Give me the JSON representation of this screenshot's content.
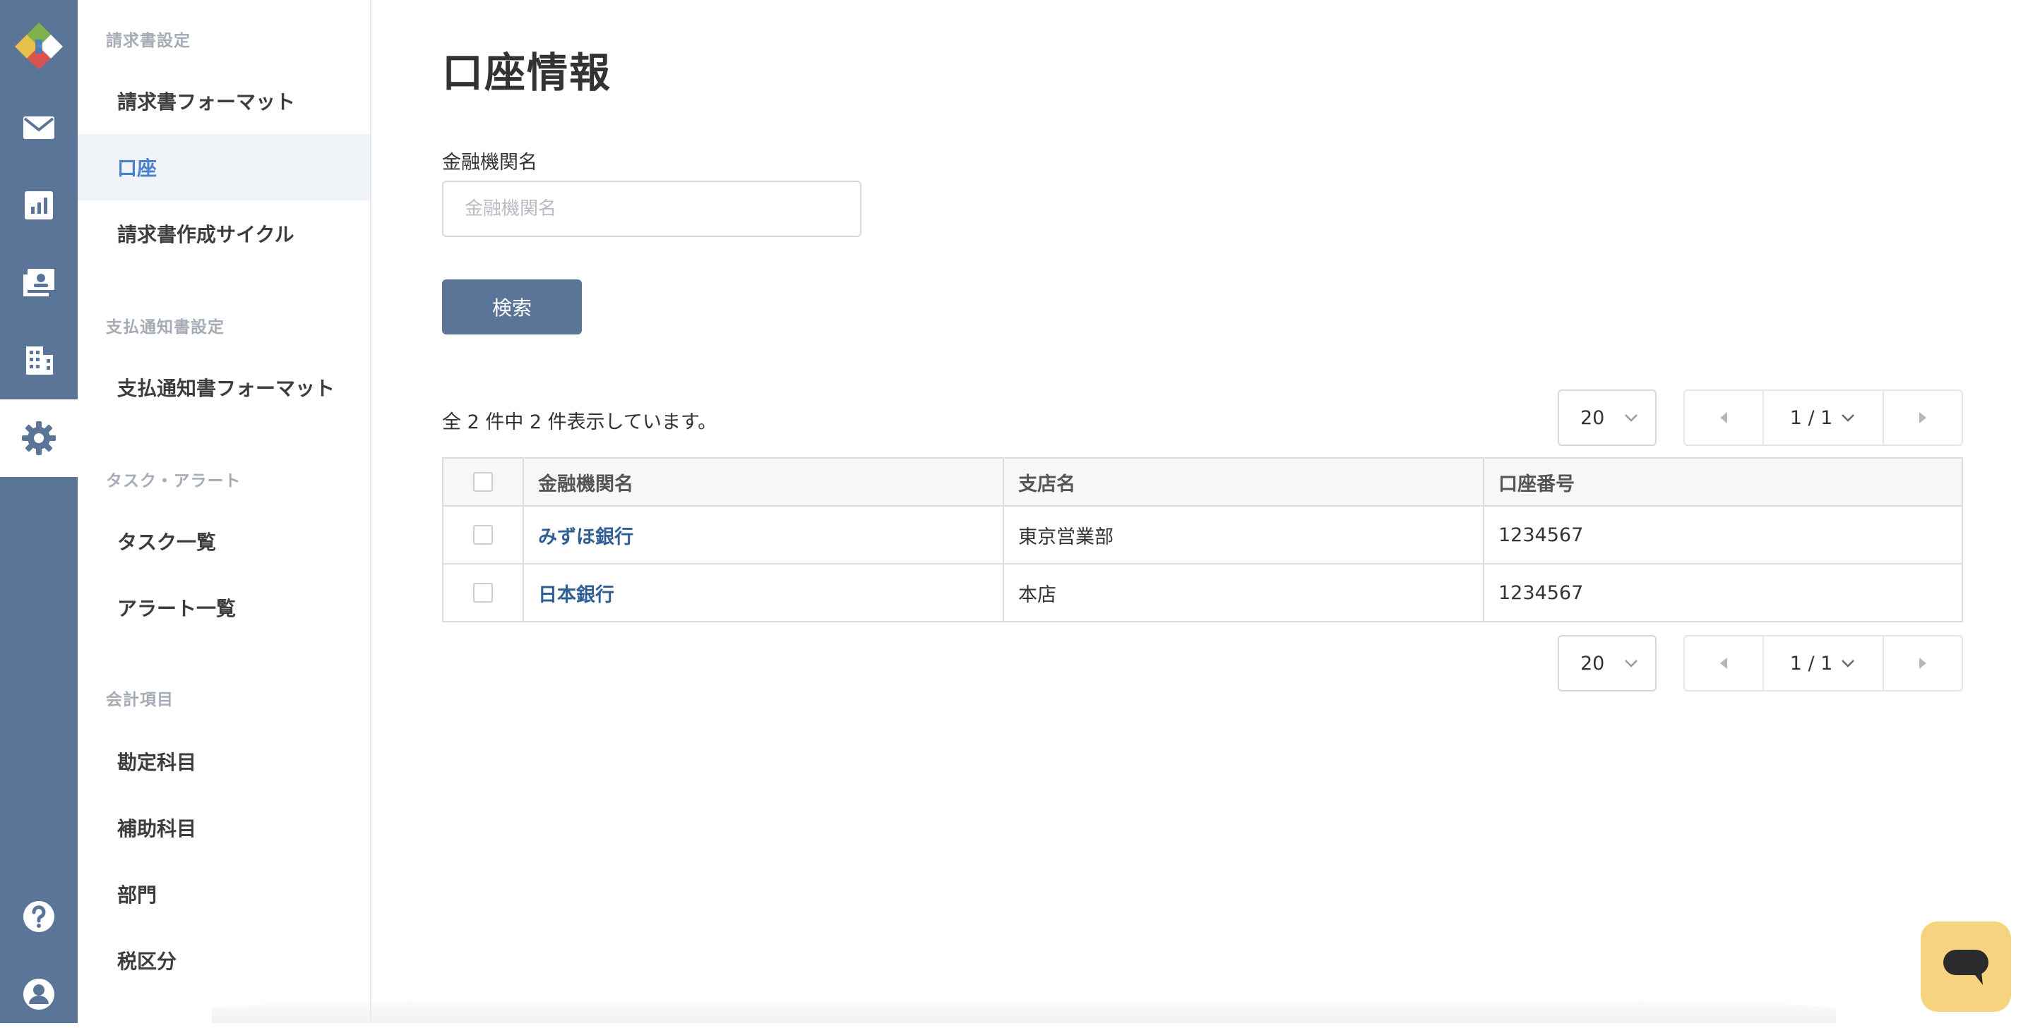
{
  "colors": {
    "rail": "#5b7599",
    "accent_active": "#4a7fc9",
    "link": "#2f5f94",
    "chat": "#f6d37f"
  },
  "rail": {
    "items": [
      {
        "icon": "mail-icon"
      },
      {
        "icon": "chart-icon"
      },
      {
        "icon": "invoice-icon"
      },
      {
        "icon": "building-icon"
      },
      {
        "icon": "gear-icon",
        "active": true
      },
      {
        "icon": "help-icon"
      },
      {
        "icon": "user-icon"
      }
    ]
  },
  "sidebar": {
    "sections": [
      {
        "title": "請求書設定",
        "items": [
          {
            "label": "請求書フォーマット"
          },
          {
            "label": "口座",
            "active": true
          },
          {
            "label": "請求書作成サイクル"
          }
        ]
      },
      {
        "title": "支払通知書設定",
        "items": [
          {
            "label": "支払通知書フォーマット"
          }
        ]
      },
      {
        "title": "タスク・アラート",
        "items": [
          {
            "label": "タスク一覧"
          },
          {
            "label": "アラート一覧"
          }
        ]
      },
      {
        "title": "会計項目",
        "items": [
          {
            "label": "勘定科目"
          },
          {
            "label": "補助科目"
          },
          {
            "label": "部門"
          },
          {
            "label": "税区分"
          }
        ]
      }
    ]
  },
  "main": {
    "title": "口座情報",
    "search": {
      "label": "金融機関名",
      "placeholder": "金融機関名",
      "button": "検索"
    },
    "result_count": "全 2 件中 2 件表示しています。",
    "per_page": "20",
    "pager": {
      "current": "1 / 1"
    },
    "table": {
      "headers": [
        "金融機関名",
        "支店名",
        "口座番号"
      ],
      "rows": [
        {
          "bank": "みずほ銀行",
          "branch": "東京営業部",
          "account": "1234567"
        },
        {
          "bank": "日本銀行",
          "branch": "本店",
          "account": "1234567"
        }
      ]
    }
  }
}
